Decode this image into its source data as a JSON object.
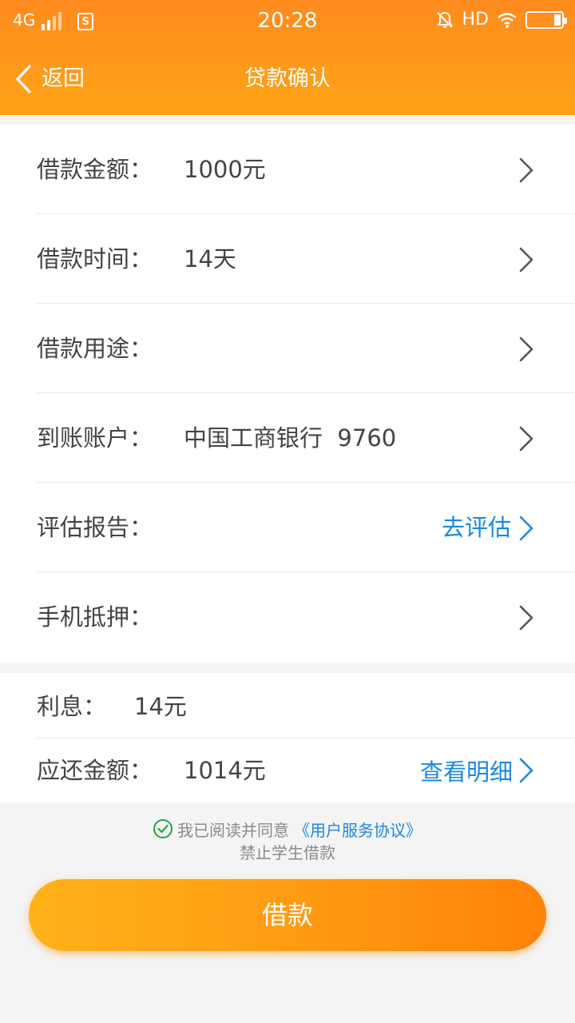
{
  "status_bar": {
    "network": "4G",
    "sim_icon_text": "S",
    "time": "20:28",
    "hd": "HD",
    "icons": [
      "signal-icon",
      "sim-icon",
      "mute-icon",
      "wifi-icon",
      "battery-icon"
    ],
    "battery_level": 0.2
  },
  "nav": {
    "back_label": "返回",
    "title": "贷款确认"
  },
  "form": {
    "rows": [
      {
        "label": "借款金额：",
        "value": "1000元",
        "link": ""
      },
      {
        "label": "借款时间：",
        "value": "14天",
        "link": ""
      },
      {
        "label": "借款用途：",
        "value": "",
        "link": ""
      },
      {
        "label": "到账账户：",
        "value": "中国工商银行  9760",
        "link": ""
      },
      {
        "label": "评估报告：",
        "value": "",
        "link": "去评估"
      },
      {
        "label": "手机抵押：",
        "value": "",
        "link": ""
      }
    ]
  },
  "summary": {
    "interest_label": "利息：",
    "interest_value": "14元",
    "repay_label": "应还金额：",
    "repay_value": "1014元",
    "detail_link": "查看明细"
  },
  "agreement": {
    "prefix": "我已阅读并同意",
    "link": "《用户服务协议》",
    "notice": "禁止学生借款"
  },
  "submit_label": "借款",
  "colors": {
    "accent": "#ff9a1a",
    "link": "#1a88e6",
    "check": "#22a640"
  }
}
